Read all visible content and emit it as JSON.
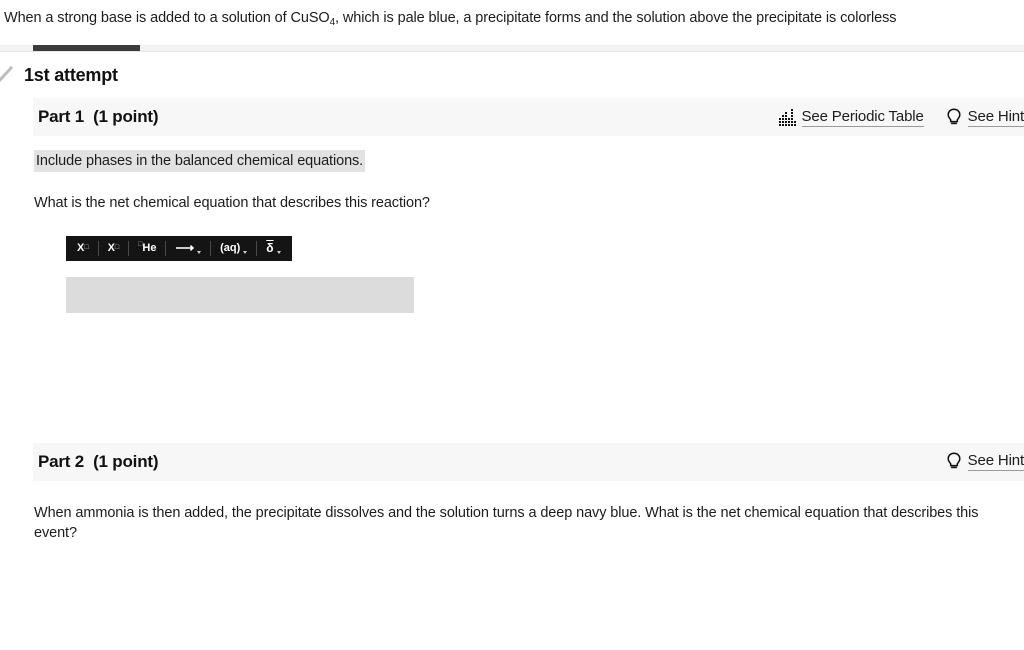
{
  "stem": {
    "text_before": "When a strong base is added to a solution of CuSO",
    "subscript": "4",
    "text_after": ", which is pale blue, a precipitate forms and the solution above the precipitate is colorless"
  },
  "attempt": {
    "label": "1st attempt",
    "status_icon": "checkmark-icon",
    "active_tab_color": "#3b3b3b"
  },
  "parts": [
    {
      "title": "Part 1",
      "points": "(1 point)",
      "tools": [
        {
          "icon": "periodic-table-icon",
          "label": "See Periodic Table"
        },
        {
          "icon": "lightbulb-icon",
          "label": "See Hint"
        }
      ],
      "instruction": "Include phases in the balanced chemical equations.",
      "question": "What is the net chemical equation that describes this reaction?",
      "editor": {
        "buttons": [
          {
            "name": "superscript-button",
            "base": "X",
            "sup": "□"
          },
          {
            "name": "subscript-button",
            "base": "X",
            "sub": "□"
          },
          {
            "name": "isotope-button",
            "pre": "□",
            "base": "He"
          },
          {
            "name": "arrow-button",
            "glyph": "⟶",
            "has_caret": true
          },
          {
            "name": "phase-button",
            "base": "(aq)",
            "has_caret": true
          },
          {
            "name": "special-char-button",
            "base": "δ",
            "overbar": true,
            "has_caret": true
          }
        ],
        "input_value": "",
        "input_placeholder": ""
      }
    },
    {
      "title": "Part 2",
      "points": "(1 point)",
      "tools": [
        {
          "icon": "lightbulb-icon",
          "label": "See Hint"
        }
      ],
      "question": "When ammonia is then added, the precipitate dissolves and the solution turns a deep navy blue. What is the net chemical equation that describes this event?"
    }
  ],
  "colors": {
    "header_bg": "#f7f7f7",
    "highlight_bg": "#e2e2e2",
    "input_bg": "#dcdcdc",
    "toolbar_bg": "#141414"
  }
}
